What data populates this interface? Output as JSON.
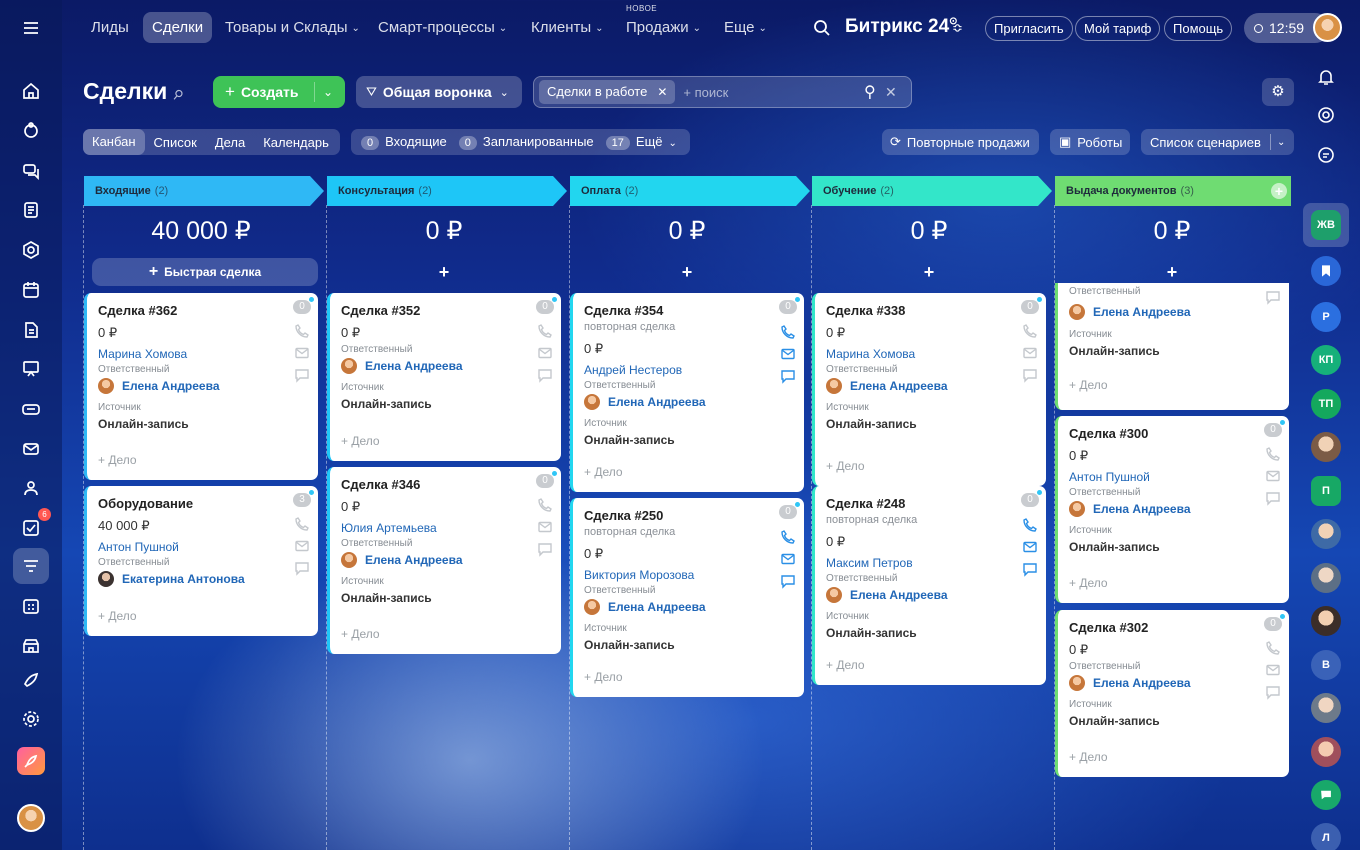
{
  "topnav": {
    "items": [
      {
        "label": "Лиды",
        "chevron": false
      },
      {
        "label": "Сделки",
        "chevron": false
      },
      {
        "label": "Товары и Склады",
        "chevron": true
      },
      {
        "label": "Смарт-процессы",
        "chevron": true
      },
      {
        "label": "Клиенты",
        "chevron": true
      },
      {
        "label": "Продажи",
        "chevron": true,
        "badge": "НОВОЕ"
      },
      {
        "label": "Еще",
        "chevron": true
      }
    ],
    "brand": "Битрикс 24",
    "invite": "Пригласить",
    "tariff": "Мой тариф",
    "help": "Помощь",
    "clock": "12:59"
  },
  "toolbar": {
    "title": "Сделки",
    "create": "Создать",
    "funnel": "Общая воронка",
    "filter_tag": "Сделки в работе",
    "search_placeholder": "+ поиск",
    "views": [
      "Канбан",
      "Список",
      "Дела",
      "Календарь"
    ],
    "counters": [
      {
        "count": "0",
        "label": "Входящие"
      },
      {
        "count": "0",
        "label": "Запланированные"
      },
      {
        "count": "17",
        "label": "Ещё"
      }
    ],
    "repeat_sales": "Повторные продажи",
    "robots": "Роботы",
    "scenarios": "Список сценариев"
  },
  "labels": {
    "responsible": "Ответственный",
    "source": "Источник",
    "add_task": "+ Дело",
    "quick_deal": "Быстрая сделка",
    "repeat": "повторная сделка",
    "add": "+"
  },
  "rightbar": [
    "ЖВ",
    "Р",
    "КП",
    "ТП",
    "П",
    "В",
    "Л"
  ],
  "columns": [
    {
      "name": "Входящие",
      "count": "(2)",
      "sum": "40 000 ₽",
      "color": "#2fb8f5",
      "cards": [
        {
          "title": "Сделка #362",
          "amount": "0 ₽",
          "client": "Марина Хомова",
          "responsible": "Елена Андреева",
          "source": "Онлайн-запись",
          "count": "0"
        },
        {
          "title": "Оборудование",
          "amount": "40 000 ₽",
          "client": "Антон Пушной",
          "responsible": "Екатерина Антонова",
          "source": "",
          "count": "3"
        }
      ]
    },
    {
      "name": "Консультация",
      "count": "(2)",
      "sum": "0 ₽",
      "color": "#1ec6f7",
      "cards": [
        {
          "title": "Сделка #352",
          "amount": "0 ₽",
          "client": "",
          "responsible": "Елена Андреева",
          "source": "Онлайн-запись",
          "count": "0"
        },
        {
          "title": "Сделка #346",
          "amount": "0 ₽",
          "client": "Юлия Артемьева",
          "responsible": "Елена Андреева",
          "source": "Онлайн-запись",
          "count": "0"
        }
      ]
    },
    {
      "name": "Оплата",
      "count": "(2)",
      "sum": "0 ₽",
      "color": "#22d6ef",
      "cards": [
        {
          "title": "Сделка #354",
          "amount": "0 ₽",
          "client": "Андрей Нестеров",
          "responsible": "Елена Андреева",
          "source": "Онлайн-запись",
          "count": "0"
        },
        {
          "title": "Сделка #250",
          "amount": "0 ₽",
          "client": "Виктория Морозова",
          "responsible": "Елена Андреева",
          "source": "Онлайн-запись",
          "count": "0"
        }
      ]
    },
    {
      "name": "Обучение",
      "count": "(2)",
      "sum": "0 ₽",
      "color": "#33e6c9",
      "cards": [
        {
          "title": "Сделка #338",
          "amount": "0 ₽",
          "client": "Марина Хомова",
          "responsible": "Елена Андреева",
          "source": "Онлайн-запись",
          "count": "0"
        },
        {
          "title": "Сделка #248",
          "amount": "0 ₽",
          "client": "Максим Петров",
          "responsible": "Елена Андреева",
          "source": "Онлайн-запись",
          "count": "0"
        }
      ]
    },
    {
      "name": "Выдача документов",
      "count": "(3)",
      "sum": "0 ₽",
      "color": "#6fdc72",
      "cards": [
        {
          "title": "",
          "amount": "",
          "client": "",
          "responsible": "Елена Андреева",
          "source": "Онлайн-запись",
          "count": ""
        },
        {
          "title": "Сделка #300",
          "amount": "0 ₽",
          "client": "Антон Пушной",
          "responsible": "Елена Андреева",
          "source": "Онлайн-запись",
          "count": "0"
        },
        {
          "title": "Сделка #302",
          "amount": "0 ₽",
          "client": "",
          "responsible": "Елена Андреева",
          "source": "Онлайн-запись",
          "count": "0"
        }
      ]
    }
  ]
}
